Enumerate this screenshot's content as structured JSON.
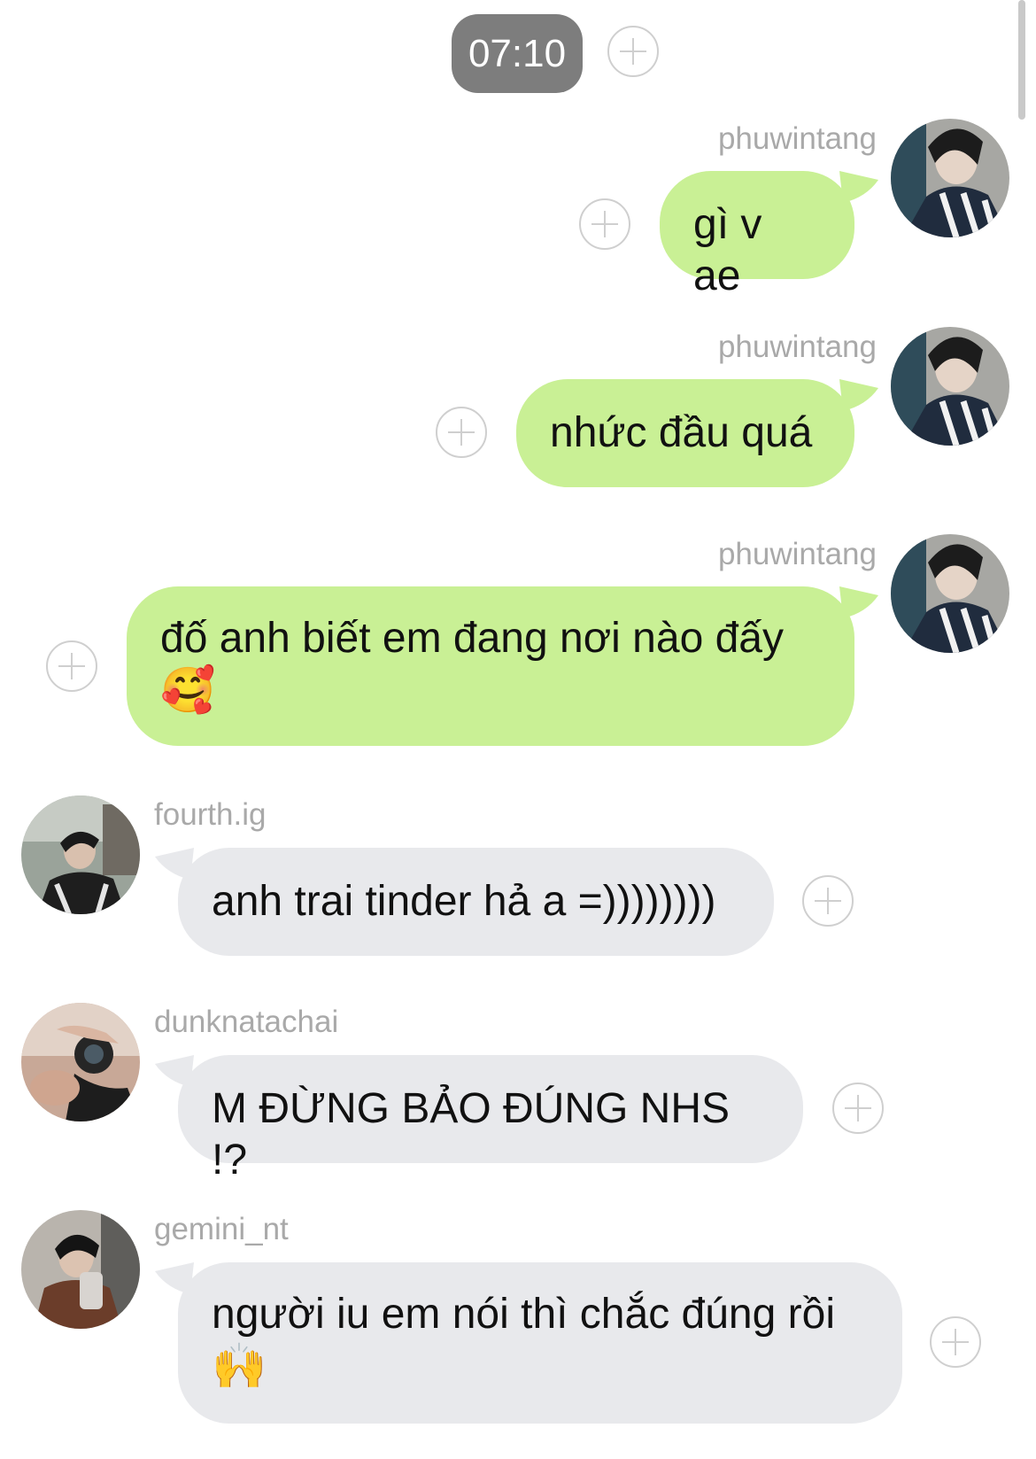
{
  "header": {
    "time": "07:10"
  },
  "messages": [
    {
      "sender": "phuwintang",
      "text": "gì v ae",
      "direction": "outgoing"
    },
    {
      "sender": "phuwintang",
      "text": "nhức đầu quá",
      "direction": "outgoing"
    },
    {
      "sender": "phuwintang",
      "text": "đố anh biết em đang nơi nào đấy",
      "emoji": "🥰",
      "direction": "outgoing"
    },
    {
      "sender": "fourth.ig",
      "text": "anh trai tinder hả a =))))))))",
      "direction": "incoming"
    },
    {
      "sender": "dunknatachai",
      "text": "M ĐỪNG BẢO ĐÚNG NHS !?",
      "direction": "incoming"
    },
    {
      "sender": "gemini_nt",
      "text": "người iu em nói thì chắc đúng rồi",
      "emoji": "🙌",
      "direction": "incoming"
    }
  ],
  "colors": {
    "outgoing_bubble": "#c9f095",
    "incoming_bubble": "#e8e9ec",
    "time_pill": "#7d7d7d",
    "sender_name": "#a9a9a9"
  },
  "icons": {
    "add": "plus-circle-icon"
  }
}
